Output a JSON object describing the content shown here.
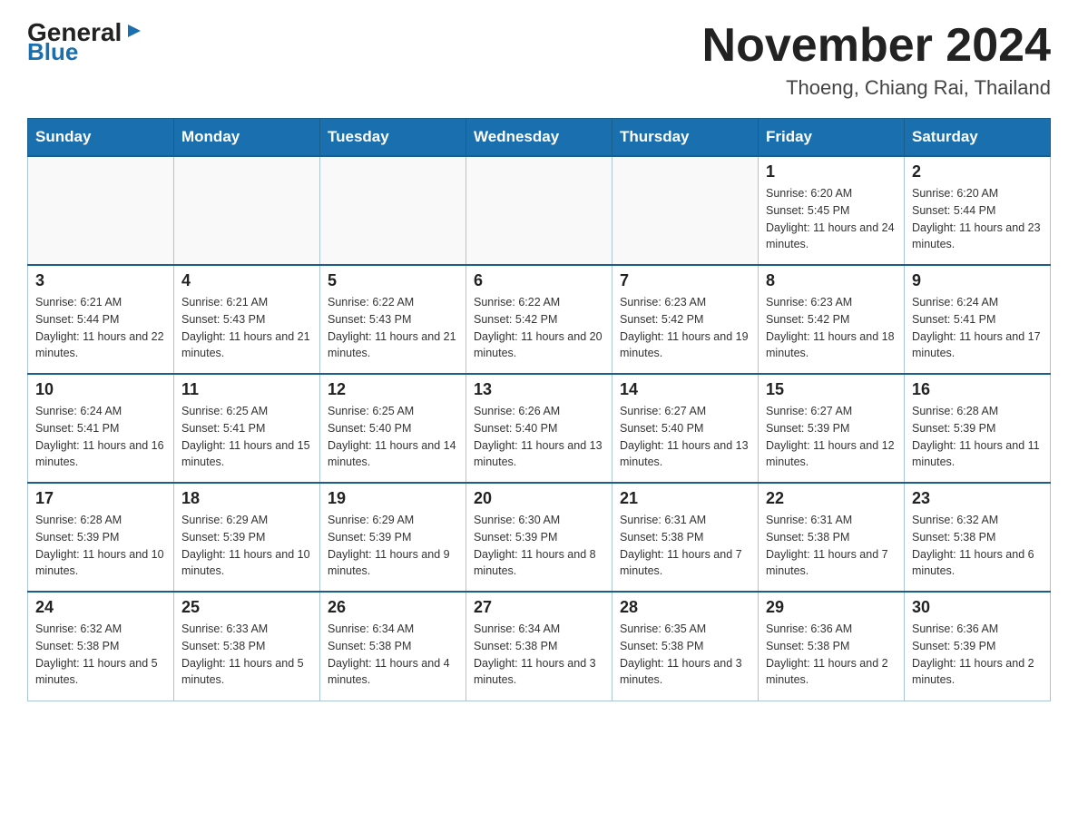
{
  "logo": {
    "general": "General",
    "blue": "Blue",
    "arrow": "▶"
  },
  "header": {
    "title": "November 2024",
    "subtitle": "Thoeng, Chiang Rai, Thailand"
  },
  "days_of_week": [
    "Sunday",
    "Monday",
    "Tuesday",
    "Wednesday",
    "Thursday",
    "Friday",
    "Saturday"
  ],
  "weeks": [
    [
      {
        "day": "",
        "info": ""
      },
      {
        "day": "",
        "info": ""
      },
      {
        "day": "",
        "info": ""
      },
      {
        "day": "",
        "info": ""
      },
      {
        "day": "",
        "info": ""
      },
      {
        "day": "1",
        "info": "Sunrise: 6:20 AM\nSunset: 5:45 PM\nDaylight: 11 hours and 24 minutes."
      },
      {
        "day": "2",
        "info": "Sunrise: 6:20 AM\nSunset: 5:44 PM\nDaylight: 11 hours and 23 minutes."
      }
    ],
    [
      {
        "day": "3",
        "info": "Sunrise: 6:21 AM\nSunset: 5:44 PM\nDaylight: 11 hours and 22 minutes."
      },
      {
        "day": "4",
        "info": "Sunrise: 6:21 AM\nSunset: 5:43 PM\nDaylight: 11 hours and 21 minutes."
      },
      {
        "day": "5",
        "info": "Sunrise: 6:22 AM\nSunset: 5:43 PM\nDaylight: 11 hours and 21 minutes."
      },
      {
        "day": "6",
        "info": "Sunrise: 6:22 AM\nSunset: 5:42 PM\nDaylight: 11 hours and 20 minutes."
      },
      {
        "day": "7",
        "info": "Sunrise: 6:23 AM\nSunset: 5:42 PM\nDaylight: 11 hours and 19 minutes."
      },
      {
        "day": "8",
        "info": "Sunrise: 6:23 AM\nSunset: 5:42 PM\nDaylight: 11 hours and 18 minutes."
      },
      {
        "day": "9",
        "info": "Sunrise: 6:24 AM\nSunset: 5:41 PM\nDaylight: 11 hours and 17 minutes."
      }
    ],
    [
      {
        "day": "10",
        "info": "Sunrise: 6:24 AM\nSunset: 5:41 PM\nDaylight: 11 hours and 16 minutes."
      },
      {
        "day": "11",
        "info": "Sunrise: 6:25 AM\nSunset: 5:41 PM\nDaylight: 11 hours and 15 minutes."
      },
      {
        "day": "12",
        "info": "Sunrise: 6:25 AM\nSunset: 5:40 PM\nDaylight: 11 hours and 14 minutes."
      },
      {
        "day": "13",
        "info": "Sunrise: 6:26 AM\nSunset: 5:40 PM\nDaylight: 11 hours and 13 minutes."
      },
      {
        "day": "14",
        "info": "Sunrise: 6:27 AM\nSunset: 5:40 PM\nDaylight: 11 hours and 13 minutes."
      },
      {
        "day": "15",
        "info": "Sunrise: 6:27 AM\nSunset: 5:39 PM\nDaylight: 11 hours and 12 minutes."
      },
      {
        "day": "16",
        "info": "Sunrise: 6:28 AM\nSunset: 5:39 PM\nDaylight: 11 hours and 11 minutes."
      }
    ],
    [
      {
        "day": "17",
        "info": "Sunrise: 6:28 AM\nSunset: 5:39 PM\nDaylight: 11 hours and 10 minutes."
      },
      {
        "day": "18",
        "info": "Sunrise: 6:29 AM\nSunset: 5:39 PM\nDaylight: 11 hours and 10 minutes."
      },
      {
        "day": "19",
        "info": "Sunrise: 6:29 AM\nSunset: 5:39 PM\nDaylight: 11 hours and 9 minutes."
      },
      {
        "day": "20",
        "info": "Sunrise: 6:30 AM\nSunset: 5:39 PM\nDaylight: 11 hours and 8 minutes."
      },
      {
        "day": "21",
        "info": "Sunrise: 6:31 AM\nSunset: 5:38 PM\nDaylight: 11 hours and 7 minutes."
      },
      {
        "day": "22",
        "info": "Sunrise: 6:31 AM\nSunset: 5:38 PM\nDaylight: 11 hours and 7 minutes."
      },
      {
        "day": "23",
        "info": "Sunrise: 6:32 AM\nSunset: 5:38 PM\nDaylight: 11 hours and 6 minutes."
      }
    ],
    [
      {
        "day": "24",
        "info": "Sunrise: 6:32 AM\nSunset: 5:38 PM\nDaylight: 11 hours and 5 minutes."
      },
      {
        "day": "25",
        "info": "Sunrise: 6:33 AM\nSunset: 5:38 PM\nDaylight: 11 hours and 5 minutes."
      },
      {
        "day": "26",
        "info": "Sunrise: 6:34 AM\nSunset: 5:38 PM\nDaylight: 11 hours and 4 minutes."
      },
      {
        "day": "27",
        "info": "Sunrise: 6:34 AM\nSunset: 5:38 PM\nDaylight: 11 hours and 3 minutes."
      },
      {
        "day": "28",
        "info": "Sunrise: 6:35 AM\nSunset: 5:38 PM\nDaylight: 11 hours and 3 minutes."
      },
      {
        "day": "29",
        "info": "Sunrise: 6:36 AM\nSunset: 5:38 PM\nDaylight: 11 hours and 2 minutes."
      },
      {
        "day": "30",
        "info": "Sunrise: 6:36 AM\nSunset: 5:39 PM\nDaylight: 11 hours and 2 minutes."
      }
    ]
  ]
}
